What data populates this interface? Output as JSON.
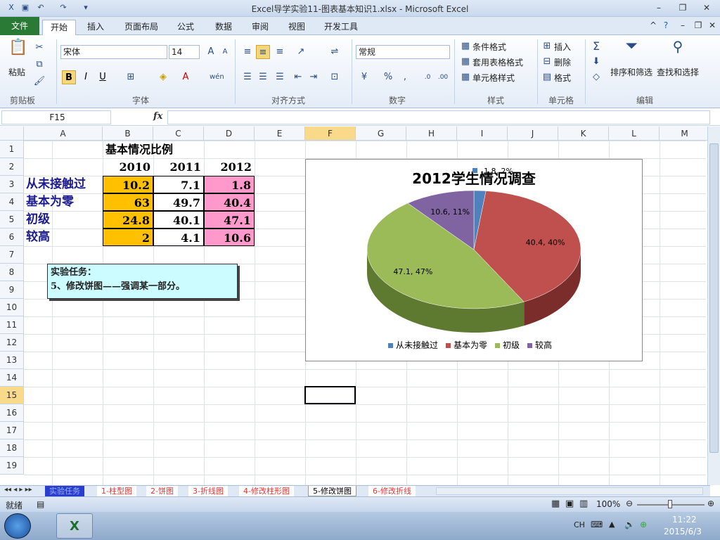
{
  "window": {
    "title": "Excel导学实验11-图表基本知识1.xlsx - Microsoft Excel"
  },
  "tabs": [
    "开始",
    "插入",
    "页面布局",
    "公式",
    "数据",
    "审阅",
    "视图",
    "开发工具"
  ],
  "file_tab": "文件",
  "ribbon": {
    "paste": "粘贴",
    "font_name": "宋体",
    "font_size": "14",
    "number_format": "常规",
    "cond_format": "条件格式",
    "table_format": "套用表格格式",
    "cell_style": "单元格样式",
    "insert": "插入",
    "delete": "删除",
    "format": "格式",
    "sort": "排序和筛选",
    "find": "查找和选择",
    "groups": [
      "剪贴板",
      "字体",
      "对齐方式",
      "数字",
      "样式",
      "单元格",
      "编辑"
    ]
  },
  "formula_bar": {
    "name_box": "F15",
    "fx": "fx",
    "value": ""
  },
  "columns": [
    "A",
    "B",
    "C",
    "D",
    "E",
    "F",
    "G",
    "H",
    "I",
    "J",
    "K",
    "L",
    "M"
  ],
  "rows": [
    "1",
    "2",
    "3",
    "4",
    "5",
    "6",
    "7",
    "8",
    "9",
    "10",
    "11",
    "12",
    "13",
    "14",
    "15",
    "16",
    "17",
    "18",
    "19"
  ],
  "sheet": {
    "title": "基本情况比例",
    "years": [
      "2010",
      "2011",
      "2012"
    ],
    "labels": [
      "从未接触过",
      "基本为零",
      "初级",
      "较高"
    ],
    "data": [
      [
        "10.2",
        "7.1",
        "1.8"
      ],
      [
        "63",
        "49.7",
        "40.4"
      ],
      [
        "24.8",
        "40.1",
        "47.1"
      ],
      [
        "2",
        "4.1",
        "10.6"
      ]
    ]
  },
  "task": {
    "line1": "实验任务：",
    "line2": "5、修改饼图——强调某一部分。"
  },
  "chart_data": {
    "type": "pie",
    "title": "2012学生情况调查",
    "categories": [
      "从未接触过",
      "基本为零",
      "初级",
      "较高"
    ],
    "values": [
      1.8,
      40.4,
      47.1,
      10.6
    ],
    "data_labels": [
      "1.8, 2%",
      "40.4, 40%",
      "47.1, 47%",
      "10.6, 11%"
    ],
    "colors": [
      "#4f81bd",
      "#c0504d",
      "#9bbb59",
      "#8064a2"
    ],
    "side_colors": [
      "#2e5a8a",
      "#7a2d2b",
      "#5d7a30",
      "#4e3a6e"
    ],
    "legend": "bottom"
  },
  "sheet_tabs": [
    "实验任务",
    "1-柱型图",
    "2-饼图",
    "3-折线图",
    "4-修改柱形图",
    "5-修改饼图",
    "6-修改折线"
  ],
  "status": {
    "ready": "就绪",
    "zoom": "100%"
  },
  "taskbar": {
    "time": "11:22",
    "date": "2015/6/3",
    "lang": "CH"
  }
}
